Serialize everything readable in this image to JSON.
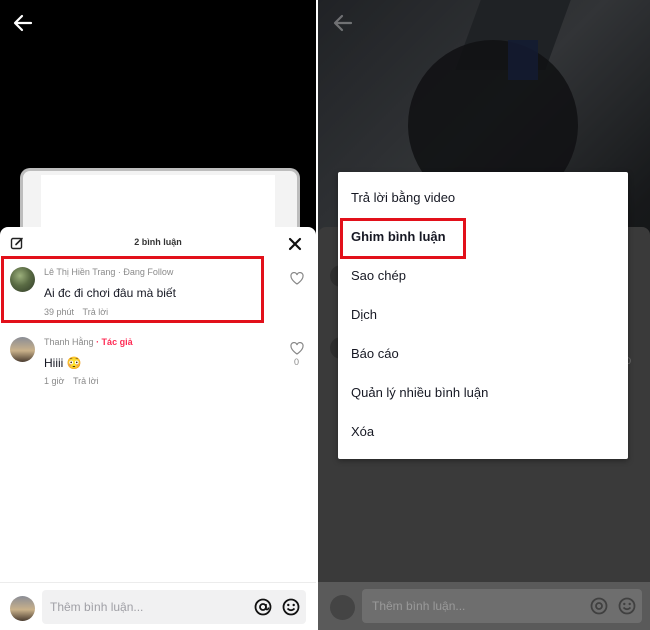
{
  "left": {
    "sheet": {
      "comment_count_label": "2 bình luận"
    },
    "comments": [
      {
        "user": "Lê Thị Hiền Trang",
        "tag": "· Đang Follow",
        "text": "Ai đc đi chơi đâu mà biết",
        "time": "39 phút",
        "reply": "Trả lời"
      },
      {
        "user": "Thanh Hằng",
        "tag": "· Tác giả",
        "text": "Hiiii 😳",
        "time": "1 giờ",
        "reply": "Trả lời",
        "likes": "0"
      }
    ],
    "input": {
      "placeholder": "Thêm bình luận..."
    }
  },
  "right": {
    "menu": {
      "items": [
        "Trả lời bằng video",
        "Ghim bình luận",
        "Sao chép",
        "Dịch",
        "Báo cáo",
        "Quản lý nhiều bình luận",
        "Xóa"
      ]
    },
    "input": {
      "placeholder": "Thêm bình luận..."
    },
    "ghost_likes": "0"
  },
  "colors": {
    "highlight": "#e2101a",
    "author_tag": "#fe2c55"
  },
  "icons": [
    "back-arrow-icon",
    "edit-icon",
    "close-icon",
    "heart-icon",
    "at-icon",
    "emoji-icon"
  ]
}
